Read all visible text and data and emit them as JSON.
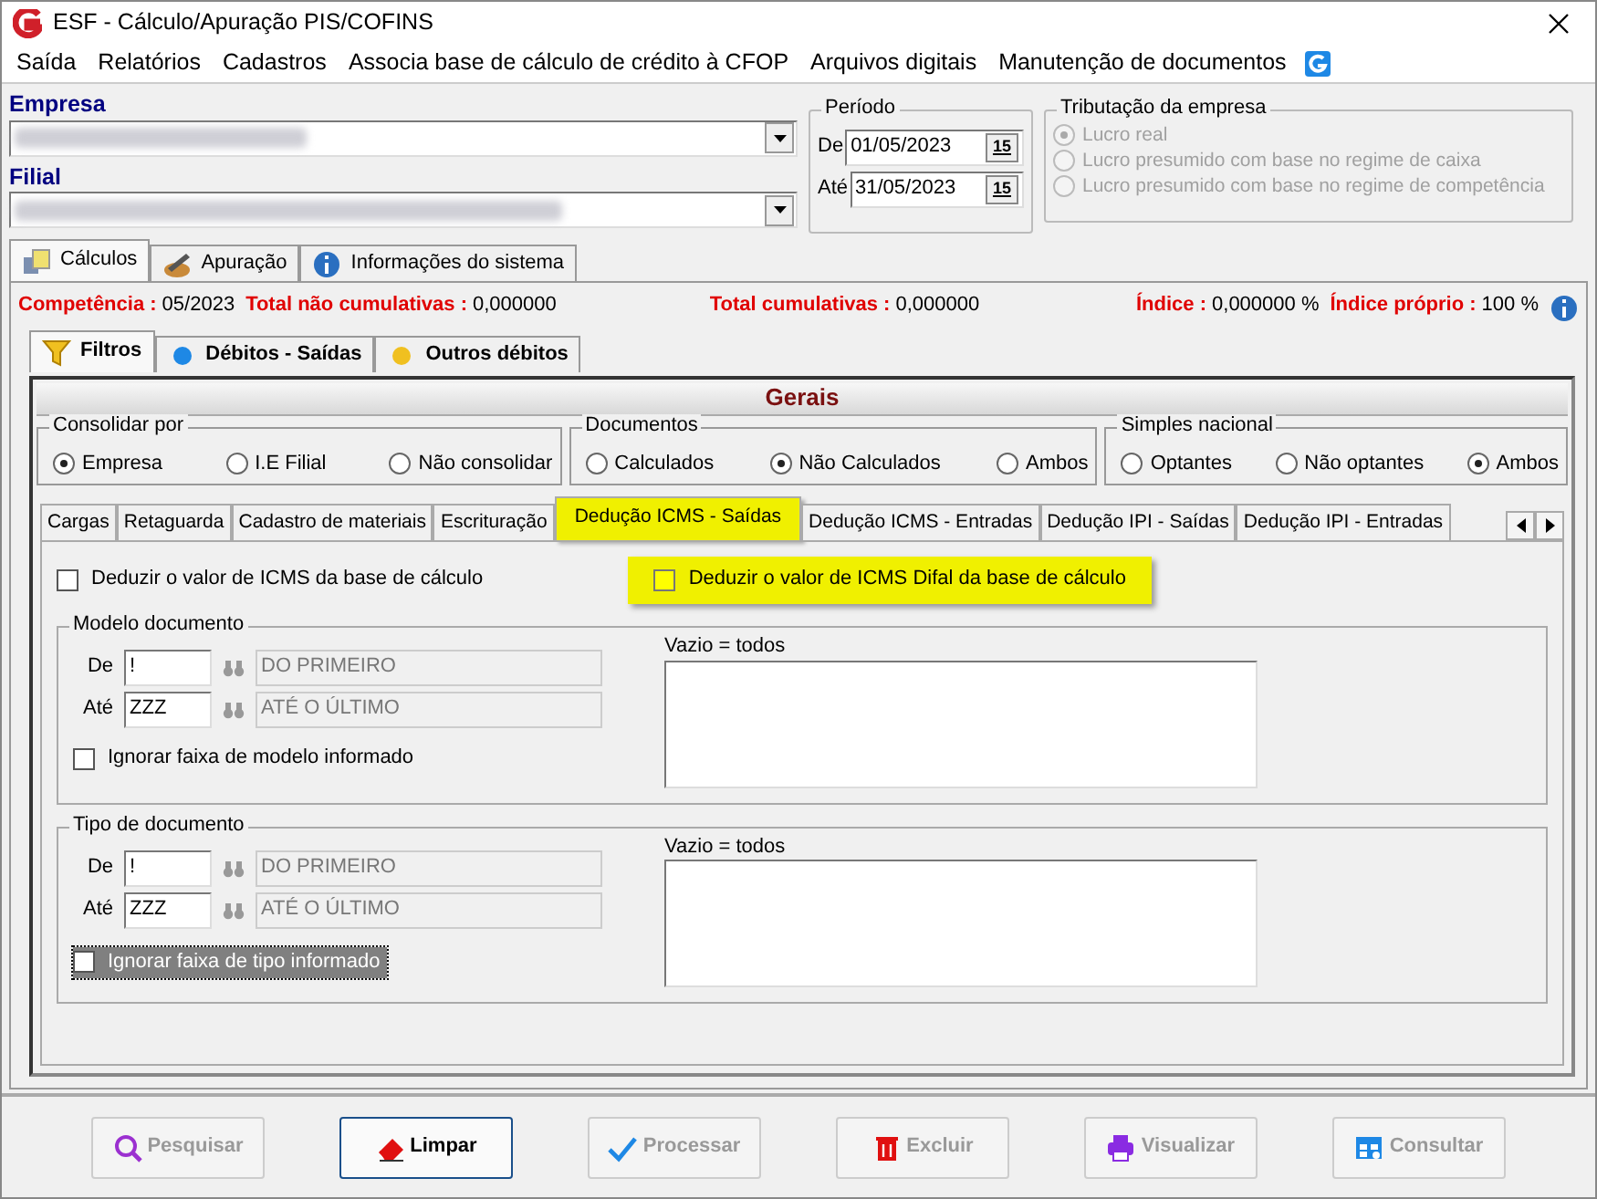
{
  "window": {
    "title": "ESF - Cálculo/Apuração PIS/COFINS"
  },
  "menu": [
    {
      "label": "Saída"
    },
    {
      "label": "Relatórios"
    },
    {
      "label": "Cadastros"
    },
    {
      "label": "Associa base de cálculo de crédito à CFOP"
    },
    {
      "label": "Arquivos digitais"
    },
    {
      "label": "Manutenção de documentos"
    }
  ],
  "empresa": {
    "label": "Empresa"
  },
  "filial": {
    "label": "Filial"
  },
  "periodo": {
    "label": "Período",
    "rows": [
      {
        "label": "De",
        "value": "01/05/2023",
        "calendar": "15"
      },
      {
        "label": "Até",
        "value": "31/05/2023",
        "calendar": "15"
      }
    ]
  },
  "tributacao": {
    "label": "Tributação da empresa",
    "disabled": true,
    "options": [
      {
        "label": "Lucro real",
        "selected": true
      },
      {
        "label": "Lucro presumido com base no regime de caixa",
        "selected": false
      },
      {
        "label": "Lucro presumido com base no regime de competência",
        "selected": false
      }
    ]
  },
  "main_tabs": [
    {
      "label": "Cálculos",
      "kind": "calc",
      "selected": true
    },
    {
      "label": "Apuração",
      "kind": "pen",
      "selected": false
    },
    {
      "label": "Informações do sistema",
      "kind": "info",
      "selected": false
    }
  ],
  "summary": [
    {
      "label": "Competência :",
      "value": "05/2023"
    },
    {
      "label": "Total não cumulativas :",
      "value": "0,000000"
    },
    {
      "label": "Total cumulativas :",
      "value": "0,000000"
    },
    {
      "label": "Índice :",
      "value": "0,000000 %"
    },
    {
      "label": "Índice próprio :",
      "value": "100 %"
    }
  ],
  "filter_tabs": [
    {
      "label": "Filtros",
      "kind": "funnel",
      "selected": true
    },
    {
      "label": "Débitos - Saídas",
      "kind": "blue",
      "selected": false
    },
    {
      "label": "Outros débitos",
      "kind": "yellow",
      "selected": false
    }
  ],
  "gerais": {
    "title": "Gerais",
    "groups": [
      {
        "label": "Consolidar por",
        "options": [
          {
            "label": "Empresa",
            "selected": true
          },
          {
            "label": "I.E Filial",
            "selected": false
          },
          {
            "label": "Não consolidar",
            "selected": false
          }
        ]
      },
      {
        "label": "Documentos",
        "options": [
          {
            "label": "Calculados",
            "selected": false
          },
          {
            "label": "Não Calculados",
            "selected": true
          },
          {
            "label": "Ambos",
            "selected": false
          }
        ]
      },
      {
        "label": "Simples nacional",
        "options": [
          {
            "label": "Optantes",
            "selected": false
          },
          {
            "label": "Não optantes",
            "selected": false
          },
          {
            "label": "Ambos",
            "selected": true
          }
        ]
      }
    ]
  },
  "section_tabs": [
    {
      "label": "Cargas",
      "selected": false
    },
    {
      "label": "Retaguarda",
      "selected": false
    },
    {
      "label": "Cadastro de materiais",
      "selected": false
    },
    {
      "label": "Escrituração",
      "selected": false
    },
    {
      "label": "Dedução ICMS - Saídas",
      "selected": true
    },
    {
      "label": "Dedução ICMS - Entradas",
      "selected": false
    },
    {
      "label": "Dedução IPI - Saídas",
      "selected": false
    },
    {
      "label": "Dedução IPI - Entradas",
      "selected": false
    }
  ],
  "checks": [
    {
      "label": "Deduzir o valor de ICMS da base de cálculo",
      "checked": false,
      "highlighted": false
    },
    {
      "label": "Deduzir o valor de ICMS Difal da base de cálculo",
      "checked": false,
      "highlighted": true
    }
  ],
  "ranges": [
    {
      "title": "Modelo documento",
      "rows": [
        {
          "label": "De",
          "code": "!",
          "description": "DO PRIMEIRO"
        },
        {
          "label": "Até",
          "code": "ZZZ",
          "description": "ATÉ O ÚLTIMO"
        }
      ],
      "list_label": "Vazio = todos",
      "ignore": {
        "label": "Ignorar faixa de modelo informado",
        "checked": false,
        "focused": false
      }
    },
    {
      "title": "Tipo de documento",
      "rows": [
        {
          "label": "De",
          "code": "!",
          "description": "DO PRIMEIRO"
        },
        {
          "label": "Até",
          "code": "ZZZ",
          "description": "ATÉ O ÚLTIMO"
        }
      ],
      "list_label": "Vazio = todos",
      "ignore": {
        "label": "Ignorar faixa de tipo informado",
        "checked": false,
        "focused": true
      }
    }
  ],
  "buttons": [
    {
      "label": "Pesquisar",
      "kind": "search",
      "default": false
    },
    {
      "label": "Limpar",
      "kind": "eraser",
      "default": true
    },
    {
      "label": "Processar",
      "kind": "check",
      "default": false
    },
    {
      "label": "Excluir",
      "kind": "trash",
      "default": false
    },
    {
      "label": "Visualizar",
      "kind": "printer",
      "default": false
    },
    {
      "label": "Consultar",
      "kind": "table",
      "default": false
    }
  ]
}
